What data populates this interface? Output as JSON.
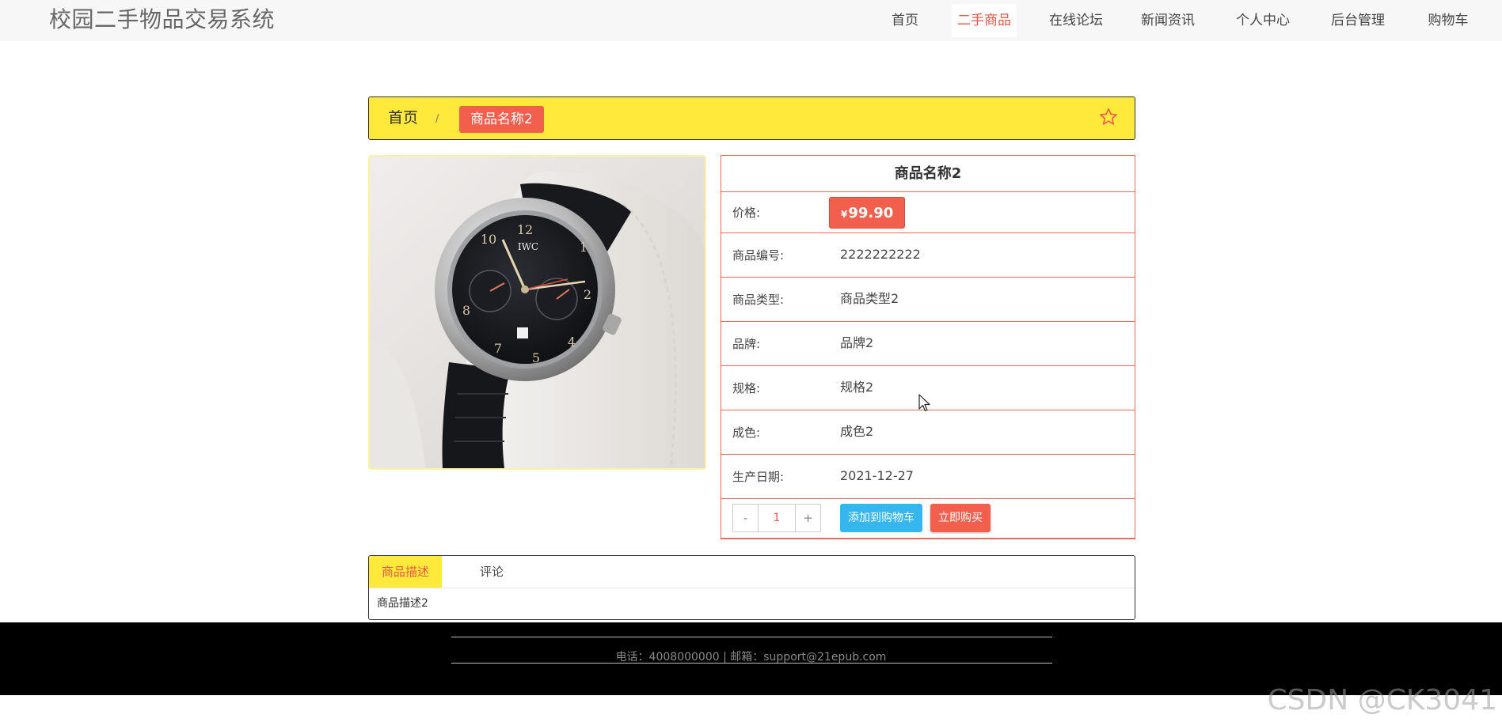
{
  "site": {
    "title": "校园二手物品交易系统"
  },
  "nav": {
    "items": [
      {
        "label": "首页"
      },
      {
        "label": "二手商品"
      },
      {
        "label": "在线论坛"
      },
      {
        "label": "新闻资讯"
      },
      {
        "label": "个人中心"
      },
      {
        "label": "后台管理"
      },
      {
        "label": "购物车"
      }
    ],
    "active_index": 1
  },
  "breadcrumb": {
    "home": "首页",
    "separator": "/",
    "current": "商品名称2"
  },
  "product": {
    "name": "商品名称2",
    "price_label": "价格:",
    "currency": "¥",
    "price": "99.90",
    "fields": [
      {
        "label": "商品编号:",
        "value": "2222222222"
      },
      {
        "label": "商品类型:",
        "value": "商品类型2"
      },
      {
        "label": "品牌:",
        "value": "品牌2"
      },
      {
        "label": "规格:",
        "value": "规格2"
      },
      {
        "label": "成色:",
        "value": "成色2"
      },
      {
        "label": "生产日期:",
        "value": "2021-12-27"
      }
    ],
    "image_icon": "wristwatch-icon"
  },
  "actions": {
    "minus": "-",
    "plus": "+",
    "quantity": "1",
    "add_to_cart": "添加到购物车",
    "buy_now": "立即购买"
  },
  "tabs": {
    "items": [
      {
        "label": "商品描述"
      },
      {
        "label": "评论"
      }
    ],
    "active_content": "商品描述2"
  },
  "footer": {
    "text": "电话：4008000000 | 邮箱：support@21epub.com"
  },
  "watermark": "CSDN @CK3041",
  "colors": {
    "accent_red": "#f2604d",
    "accent_yellow": "#ffe93a",
    "accent_blue": "#35b6ef",
    "table_border": "#ea6a5c"
  }
}
